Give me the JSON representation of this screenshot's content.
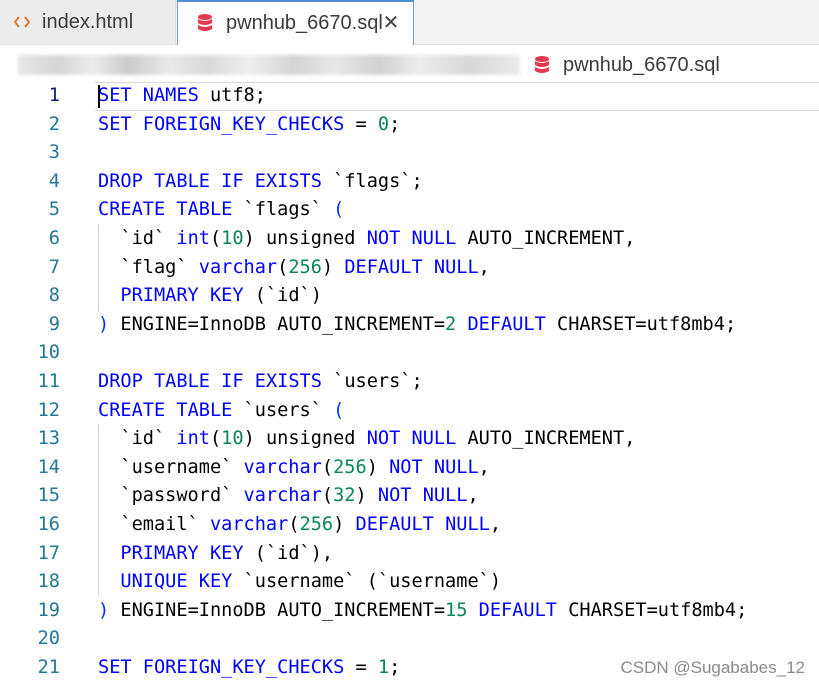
{
  "tabs": [
    {
      "label": "index.html",
      "icon": "html-code-icon",
      "active": false
    },
    {
      "label": "pwnhub_6670.sql",
      "icon": "database-icon",
      "active": true
    }
  ],
  "breadcrumb": {
    "file": "pwnhub_6670.sql"
  },
  "colors": {
    "keyword": "#0000ff",
    "number": "#098658",
    "string": "#a31515",
    "line_number": "#237893",
    "db_icon": "#e8364f",
    "html_icon": "#e37933"
  },
  "code": {
    "lines": [
      {
        "n": "1",
        "tokens": [
          [
            "kw",
            "SET"
          ],
          [
            "t",
            " "
          ],
          [
            "kw",
            "NAMES"
          ],
          [
            "t",
            " utf8;"
          ]
        ]
      },
      {
        "n": "2",
        "tokens": [
          [
            "kw",
            "SET"
          ],
          [
            "t",
            " "
          ],
          [
            "kw",
            "FOREIGN_KEY_CHECKS"
          ],
          [
            "t",
            " = "
          ],
          [
            "num",
            "0"
          ],
          [
            "t",
            ";"
          ]
        ]
      },
      {
        "n": "3",
        "tokens": []
      },
      {
        "n": "4",
        "tokens": [
          [
            "kw",
            "DROP"
          ],
          [
            "t",
            " "
          ],
          [
            "kw",
            "TABLE"
          ],
          [
            "t",
            " "
          ],
          [
            "kw",
            "IF"
          ],
          [
            "t",
            " "
          ],
          [
            "kw",
            "EXISTS"
          ],
          [
            "t",
            " `flags`;"
          ]
        ]
      },
      {
        "n": "5",
        "tokens": [
          [
            "kw",
            "CREATE"
          ],
          [
            "t",
            " "
          ],
          [
            "kw",
            "TABLE"
          ],
          [
            "t",
            " `flags` "
          ],
          [
            "paren",
            "("
          ]
        ]
      },
      {
        "n": "6",
        "tokens": [
          [
            "t",
            "  `id` "
          ],
          [
            "kw",
            "int"
          ],
          [
            "t",
            "("
          ],
          [
            "num",
            "10"
          ],
          [
            "t",
            ") unsigned "
          ],
          [
            "kw",
            "NOT"
          ],
          [
            "t",
            " "
          ],
          [
            "kw",
            "NULL"
          ],
          [
            "t",
            " AUTO_INCREMENT,"
          ]
        ]
      },
      {
        "n": "7",
        "tokens": [
          [
            "t",
            "  `flag` "
          ],
          [
            "kw",
            "varchar"
          ],
          [
            "t",
            "("
          ],
          [
            "num",
            "256"
          ],
          [
            "t",
            ") "
          ],
          [
            "kw",
            "DEFAULT"
          ],
          [
            "t",
            " "
          ],
          [
            "kw",
            "NULL"
          ],
          [
            "t",
            ","
          ]
        ]
      },
      {
        "n": "8",
        "tokens": [
          [
            "t",
            "  "
          ],
          [
            "kw",
            "PRIMARY"
          ],
          [
            "t",
            " "
          ],
          [
            "kw",
            "KEY"
          ],
          [
            "t",
            " (`id`)"
          ]
        ]
      },
      {
        "n": "9",
        "tokens": [
          [
            "paren",
            ")"
          ],
          [
            "t",
            " ENGINE=InnoDB AUTO_INCREMENT="
          ],
          [
            "num",
            "2"
          ],
          [
            "t",
            " "
          ],
          [
            "kw",
            "DEFAULT"
          ],
          [
            "t",
            " CHARSET=utf8mb4;"
          ]
        ]
      },
      {
        "n": "10",
        "tokens": []
      },
      {
        "n": "11",
        "tokens": [
          [
            "kw",
            "DROP"
          ],
          [
            "t",
            " "
          ],
          [
            "kw",
            "TABLE"
          ],
          [
            "t",
            " "
          ],
          [
            "kw",
            "IF"
          ],
          [
            "t",
            " "
          ],
          [
            "kw",
            "EXISTS"
          ],
          [
            "t",
            " `users`;"
          ]
        ]
      },
      {
        "n": "12",
        "tokens": [
          [
            "kw",
            "CREATE"
          ],
          [
            "t",
            " "
          ],
          [
            "kw",
            "TABLE"
          ],
          [
            "t",
            " `users` "
          ],
          [
            "paren",
            "("
          ]
        ]
      },
      {
        "n": "13",
        "tokens": [
          [
            "t",
            "  `id` "
          ],
          [
            "kw",
            "int"
          ],
          [
            "t",
            "("
          ],
          [
            "num",
            "10"
          ],
          [
            "t",
            ") unsigned "
          ],
          [
            "kw",
            "NOT"
          ],
          [
            "t",
            " "
          ],
          [
            "kw",
            "NULL"
          ],
          [
            "t",
            " AUTO_INCREMENT,"
          ]
        ]
      },
      {
        "n": "14",
        "tokens": [
          [
            "t",
            "  `username` "
          ],
          [
            "kw",
            "varchar"
          ],
          [
            "t",
            "("
          ],
          [
            "num",
            "256"
          ],
          [
            "t",
            ") "
          ],
          [
            "kw",
            "NOT"
          ],
          [
            "t",
            " "
          ],
          [
            "kw",
            "NULL"
          ],
          [
            "t",
            ","
          ]
        ]
      },
      {
        "n": "15",
        "tokens": [
          [
            "t",
            "  `password` "
          ],
          [
            "kw",
            "varchar"
          ],
          [
            "t",
            "("
          ],
          [
            "num",
            "32"
          ],
          [
            "t",
            ") "
          ],
          [
            "kw",
            "NOT"
          ],
          [
            "t",
            " "
          ],
          [
            "kw",
            "NULL"
          ],
          [
            "t",
            ","
          ]
        ]
      },
      {
        "n": "16",
        "tokens": [
          [
            "t",
            "  `email` "
          ],
          [
            "kw",
            "varchar"
          ],
          [
            "t",
            "("
          ],
          [
            "num",
            "256"
          ],
          [
            "t",
            ") "
          ],
          [
            "kw",
            "DEFAULT"
          ],
          [
            "t",
            " "
          ],
          [
            "kw",
            "NULL"
          ],
          [
            "t",
            ","
          ]
        ]
      },
      {
        "n": "17",
        "tokens": [
          [
            "t",
            "  "
          ],
          [
            "kw",
            "PRIMARY"
          ],
          [
            "t",
            " "
          ],
          [
            "kw",
            "KEY"
          ],
          [
            "t",
            " (`id`),"
          ]
        ]
      },
      {
        "n": "18",
        "tokens": [
          [
            "t",
            "  "
          ],
          [
            "kw",
            "UNIQUE"
          ],
          [
            "t",
            " "
          ],
          [
            "kw",
            "KEY"
          ],
          [
            "t",
            " `username` (`username`)"
          ]
        ]
      },
      {
        "n": "19",
        "tokens": [
          [
            "paren",
            ")"
          ],
          [
            "t",
            " ENGINE=InnoDB AUTO_INCREMENT="
          ],
          [
            "num",
            "15"
          ],
          [
            "t",
            " "
          ],
          [
            "kw",
            "DEFAULT"
          ],
          [
            "t",
            " CHARSET=utf8mb4;"
          ]
        ]
      },
      {
        "n": "20",
        "tokens": []
      },
      {
        "n": "21",
        "tokens": [
          [
            "kw",
            "SET"
          ],
          [
            "t",
            " "
          ],
          [
            "kw",
            "FOREIGN_KEY_CHECKS"
          ],
          [
            "t",
            " = "
          ],
          [
            "num",
            "1"
          ],
          [
            "t",
            ";"
          ]
        ]
      }
    ]
  },
  "watermark": "CSDN @Sugababes_12"
}
